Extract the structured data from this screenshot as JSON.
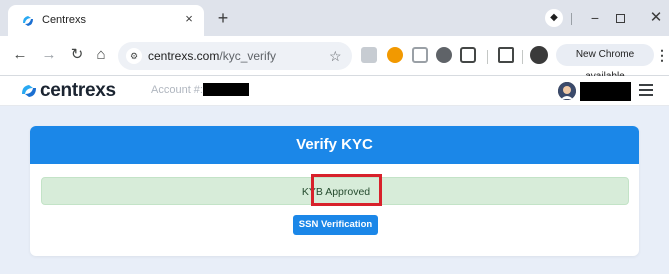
{
  "browser": {
    "tab": {
      "title": "Centrexs",
      "close_glyph": "×",
      "favicon": "centrexs-logo-icon"
    },
    "new_tab_glyph": "+",
    "tab_search_glyph": "◆",
    "window": {
      "minimize_glyph": "−",
      "close_glyph": "✕"
    },
    "nav": {
      "back_glyph": "←",
      "forward_glyph": "→",
      "reload_glyph": "↻",
      "home_glyph": "⌂"
    },
    "omnibox": {
      "domain": "centrexs.com",
      "path": "/kyc_verify",
      "site_info_glyph": "⚙"
    },
    "bookmark_glyph": "☆",
    "update_text": "New Chrome available",
    "menu_glyph": "⋮",
    "extension_colors": [
      "#c7ccd2",
      "#f29900",
      "#9aa0a6",
      "#5f6368",
      "#444746"
    ]
  },
  "site": {
    "logo_text": "centrexs",
    "account_label": "Account #:",
    "brand_color": "#1b87e8"
  },
  "main": {
    "title": "Verify KYC",
    "status": "KYB Approved",
    "button": "SSN Verification",
    "highlight_color": "#d8212b"
  }
}
